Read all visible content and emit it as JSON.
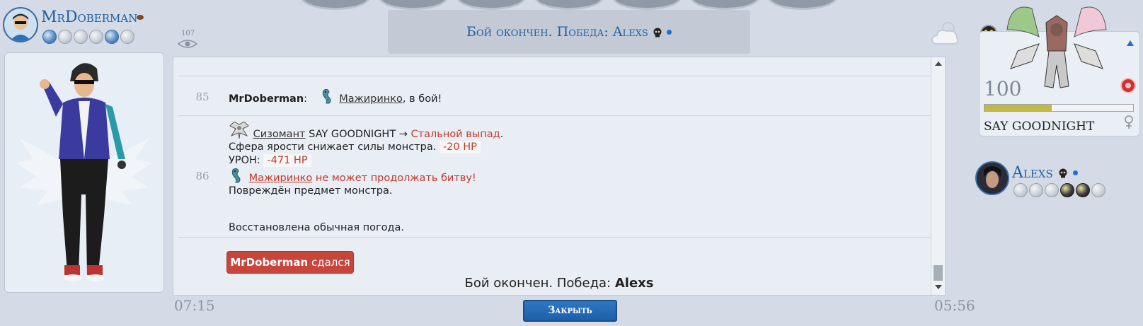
{
  "left_player": {
    "name": "MrDoberman",
    "balls": [
      "blue",
      "gray",
      "gray",
      "gray",
      "blue",
      "gray"
    ]
  },
  "view_count": "107",
  "banner": {
    "text": "Бой окончен. Победа: Alexs"
  },
  "log": {
    "turn85": {
      "number": "85",
      "player": "MrDoberman",
      "sep": ":",
      "monster": "Мажиринко",
      "rest": ", в бой!"
    },
    "turn86": {
      "number": "86",
      "attacker": "Сизомант",
      "move_pre": "SAY GOODNIGHT →",
      "move": "Стальной выпад",
      "move_end": ".",
      "line2": "Сфера ярости снижает силы монстра.",
      "dmg1": "-20 HP",
      "line3": "УРОН:",
      "dmg2": "-471 HP",
      "fainted_monster": "Мажиринко",
      "fainted_text": "не может продолжать битву!",
      "line5": "Повреждён предмет монстра.",
      "line6": "Восстановлена обычная погода."
    }
  },
  "surrender": {
    "name": "MrDoberman",
    "text": "сдался"
  },
  "final": {
    "prefix": "Бой окончен. Победа:",
    "winner": "Alexs"
  },
  "clocks": {
    "left": "07:15",
    "right": "05:56"
  },
  "close_button": "Закрыть",
  "opponent_monster": {
    "level": "100",
    "name": "SAY GOODNIGHT",
    "hp_fraction": 0.45
  },
  "right_player": {
    "name": "Alexs",
    "balls": [
      "gray",
      "gray",
      "gray",
      "dark",
      "dark",
      "gray"
    ]
  },
  "colors": {
    "accent": "#1f5f9f",
    "danger": "#c0392b",
    "hp": "#c2b94a"
  }
}
